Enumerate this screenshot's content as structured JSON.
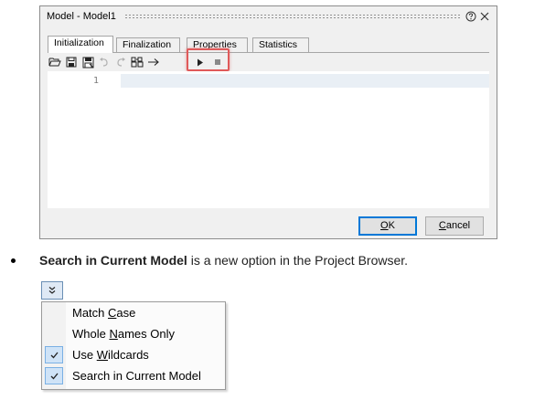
{
  "dialog": {
    "title": "Model - Model1",
    "tabs": [
      "Initialization",
      "Finalization",
      "Properties",
      "Statistics"
    ],
    "active_tab": "Initialization",
    "toolbar_icons": [
      "open-folder-icon",
      "save-icon",
      "save-as-icon",
      "undo-icon",
      "redo-icon",
      "find-replace-icon",
      "goto-arrow-icon",
      "run-icon",
      "stop-icon"
    ],
    "editor": {
      "line_number": "1"
    },
    "ok_pre": "",
    "ok_mn": "O",
    "ok_post": "K",
    "cancel_pre": "",
    "cancel_mn": "C",
    "cancel_post": "ancel"
  },
  "note": {
    "bold": "Search in Current Model",
    "rest": " is a new option in the Project Browser."
  },
  "search_options": {
    "items": [
      {
        "pre": "Match ",
        "mn": "C",
        "post": "ase",
        "checked": false
      },
      {
        "pre": "Whole ",
        "mn": "N",
        "post": "ames Only",
        "checked": false
      },
      {
        "pre": "Use ",
        "mn": "W",
        "post": "ildcards",
        "checked": true
      },
      {
        "pre": "Search in Current Model",
        "mn": "",
        "post": "",
        "checked": true
      }
    ]
  },
  "colors": {
    "highlight": "#e05a5a",
    "ok_focus": "#0078d7",
    "check_bg": "#cfe3f7"
  }
}
